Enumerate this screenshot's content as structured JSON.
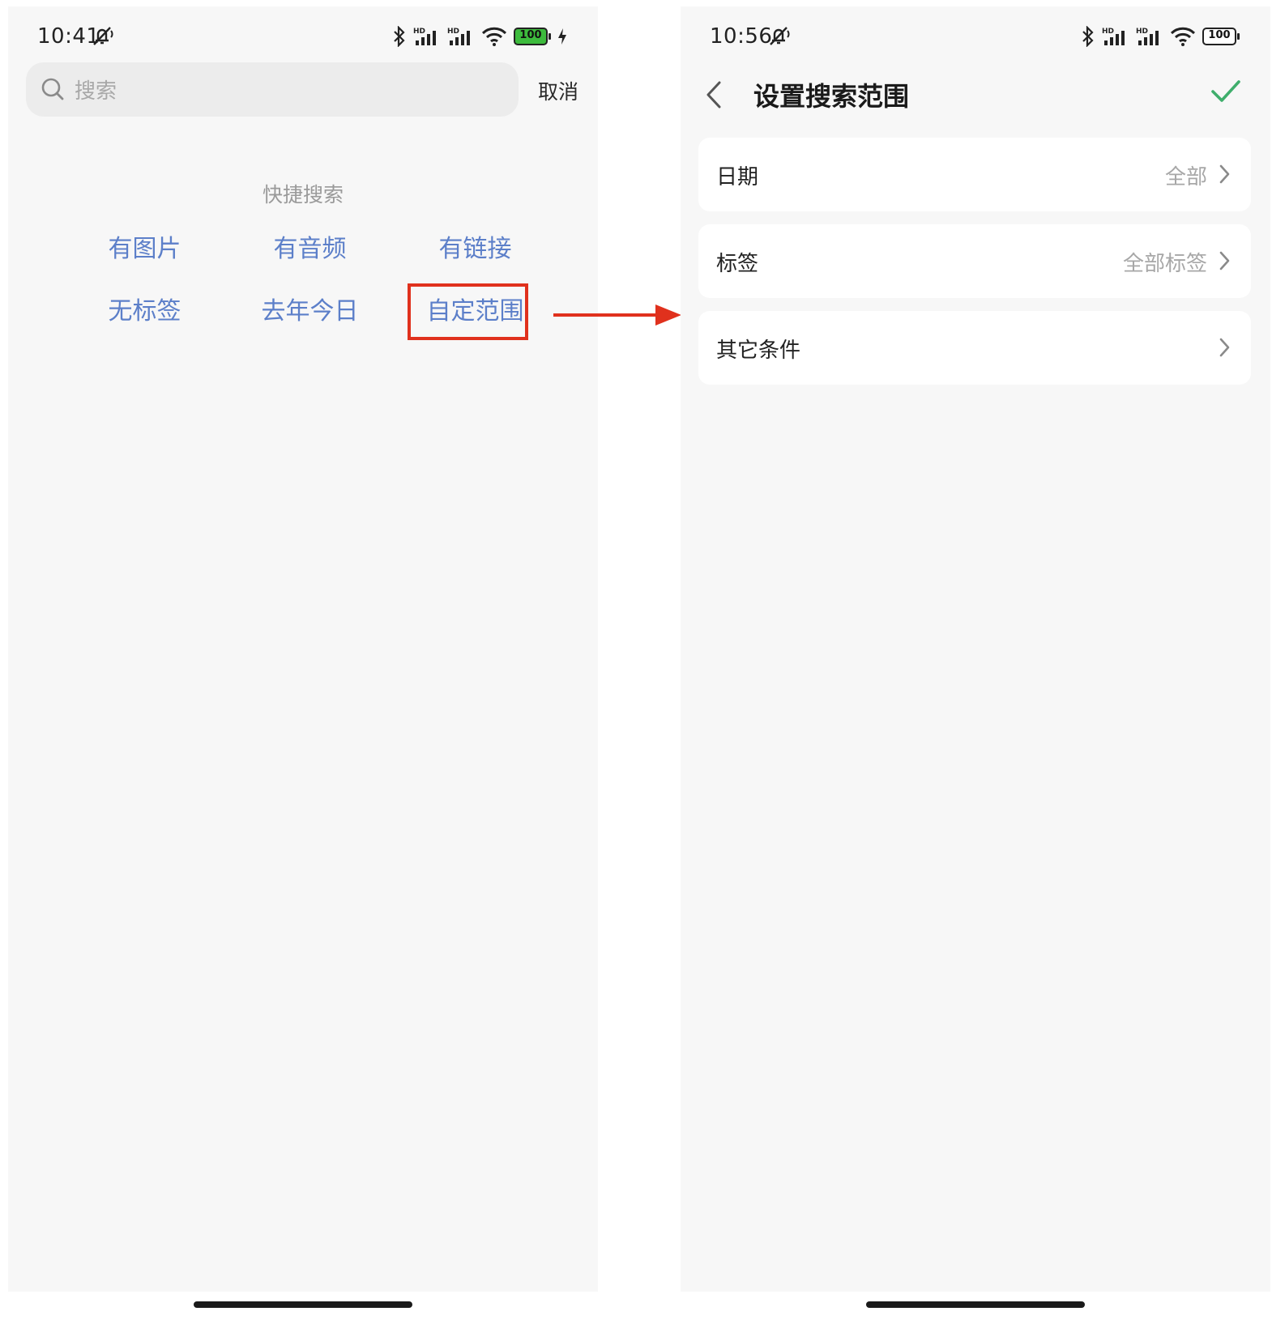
{
  "left_screen": {
    "status": {
      "time": "10:41",
      "battery": "100"
    },
    "search": {
      "placeholder": "搜索"
    },
    "cancel_label": "取消",
    "quick_search": {
      "title": "快捷搜索",
      "items": [
        "有图片",
        "有音频",
        "有链接",
        "无标签",
        "去年今日",
        "自定范围"
      ],
      "highlighted_item": "自定范围"
    }
  },
  "right_screen": {
    "status": {
      "time": "10:56",
      "battery": "100"
    },
    "title": "设置搜索范围",
    "rows": [
      {
        "label": "日期",
        "value": "全部"
      },
      {
        "label": "标签",
        "value": "全部标签"
      },
      {
        "label": "其它条件",
        "value": ""
      }
    ]
  },
  "colors": {
    "accent_blue": "#5c7fc9",
    "highlight_red": "#e0311d",
    "confirm_green": "#3fae6c",
    "battery_charging_green": "#3dbb3d",
    "background": "#f7f7f7"
  },
  "icons": [
    "mute-icon",
    "bluetooth-icon",
    "signal-icon",
    "wifi-icon",
    "battery-icon",
    "charging-icon",
    "search-icon",
    "back-icon",
    "check-icon",
    "chevron-right-icon",
    "arrow-right-icon"
  ]
}
